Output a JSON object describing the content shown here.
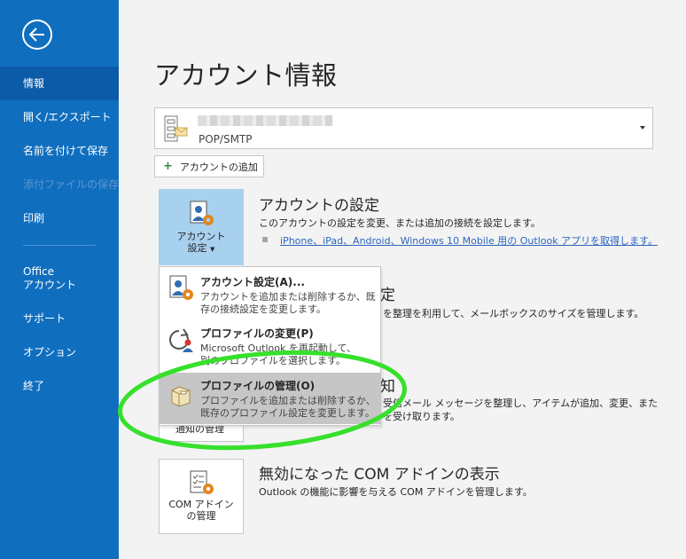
{
  "sidebar": {
    "items": [
      {
        "label": "情報",
        "state": "active"
      },
      {
        "label": "開く/エクスポート",
        "state": "normal"
      },
      {
        "label": "名前を付けて保存",
        "state": "normal"
      },
      {
        "label": "添付ファイルの保存",
        "state": "disabled"
      },
      {
        "label": "印刷",
        "state": "normal"
      },
      {
        "label": "Office\nアカウント",
        "label_line1": "Office",
        "label_line2": "アカウント",
        "state": "normal"
      },
      {
        "label": "サポート",
        "state": "normal"
      },
      {
        "label": "オプション",
        "state": "normal"
      },
      {
        "label": "終了",
        "state": "normal"
      }
    ]
  },
  "main": {
    "title": "アカウント情報",
    "account_selector": {
      "type": "POP/SMTP"
    },
    "add_account_label": "アカウントの追加",
    "account_settings": {
      "tile_line1": "アカウント",
      "tile_line2": "設定",
      "title": "アカウントの設定",
      "description": "このアカウントの設定を変更、または追加の接続を設定します。",
      "link": "iPhone、iPad、Android、Windows 10 Mobile 用の Outlook アプリを取得します。"
    },
    "mailbox": {
      "title_tail": "定",
      "description_tail": "を整理を利用して、メールボックスのサイズを管理します。"
    },
    "rules": {
      "title_tail": "知",
      "description_tail1": "受信メール メッセージを整理し、アイテムが追加、変更、また",
      "description_tail2": "を受け取ります。",
      "tile_tail": "通知の管理"
    },
    "com_addins": {
      "tile_line1": "COM アドイン",
      "tile_line2": "の管理",
      "title": "無効になった COM アドインの表示",
      "description": "Outlook の機能に影響を与える COM アドインを管理します。"
    }
  },
  "menu": {
    "items": [
      {
        "title": "アカウント設定(A)...",
        "desc1": "アカウントを追加または削除するか、既",
        "desc2": "存の接続設定を変更します。"
      },
      {
        "title": "プロファイルの変更(P)",
        "desc1": "Microsoft Outlook を再起動して、",
        "desc2": "別のプロファイルを選択します。"
      },
      {
        "title": "プロファイルの管理(O)",
        "desc1": "プロファイルを追加または削除するか、",
        "desc2": "既存のプロファイル設定を変更します。",
        "highlighted": true
      }
    ]
  },
  "colors": {
    "sidebar": "#106ebe",
    "selected_tile": "#a8d0ef",
    "highlight": "#c6c6c6",
    "annotation": "#36e02b",
    "link": "#2b66c1"
  }
}
